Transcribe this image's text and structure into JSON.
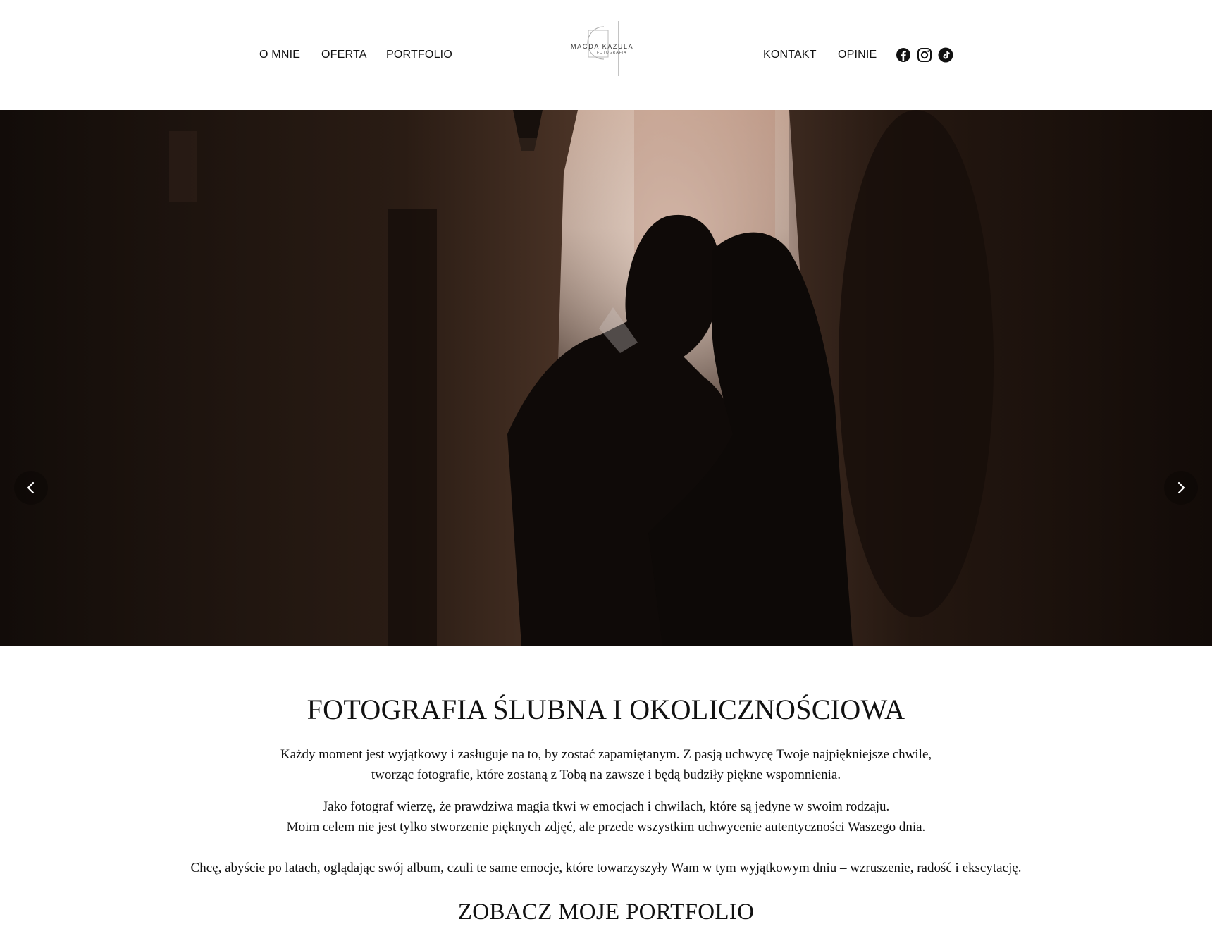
{
  "nav": {
    "left": [
      "O MNIE",
      "OFERTA",
      "PORTFOLIO"
    ],
    "right": [
      "KONTAKT",
      "OPINIE"
    ]
  },
  "logo": {
    "name": "MAGDA KAZULA",
    "sub": "FOTOGRAFIA"
  },
  "social": [
    "facebook-icon",
    "instagram-icon",
    "tiktok-icon"
  ],
  "hero": {
    "prev_icon": "chevron-left-icon",
    "next_icon": "chevron-right-icon"
  },
  "content": {
    "heading": "FOTOGRAFIA ŚLUBNA I OKOLICZNOŚCIOWA",
    "paragraph_1": [
      "Każdy moment jest wyjątkowy i zasługuje na to, by zostać zapamiętanym. Z pasją uchwycę Twoje najpiękniejsze chwile,",
      "tworząc fotografie, które zostaną z Tobą na zawsze i będą budziły piękne wspomnienia."
    ],
    "paragraph_2": [
      "Jako fotograf wierzę, że prawdziwa magia tkwi w emocjach i chwilach, które są jedyne w swoim rodzaju.",
      "Moim celem nie jest tylko stworzenie pięknych zdjęć, ale przede wszystkim uchwycenie autentyczności Waszego dnia."
    ],
    "paragraph_3": "Chcę, abyście po latach, oglądając swój album, czuli te same emocje, które towarzyszyły Wam w tym wyjątkowym dniu – wzruszenie, radość i ekscytację.",
    "portfolio_heading": "ZOBACZ MOJE PORTFOLIO"
  }
}
